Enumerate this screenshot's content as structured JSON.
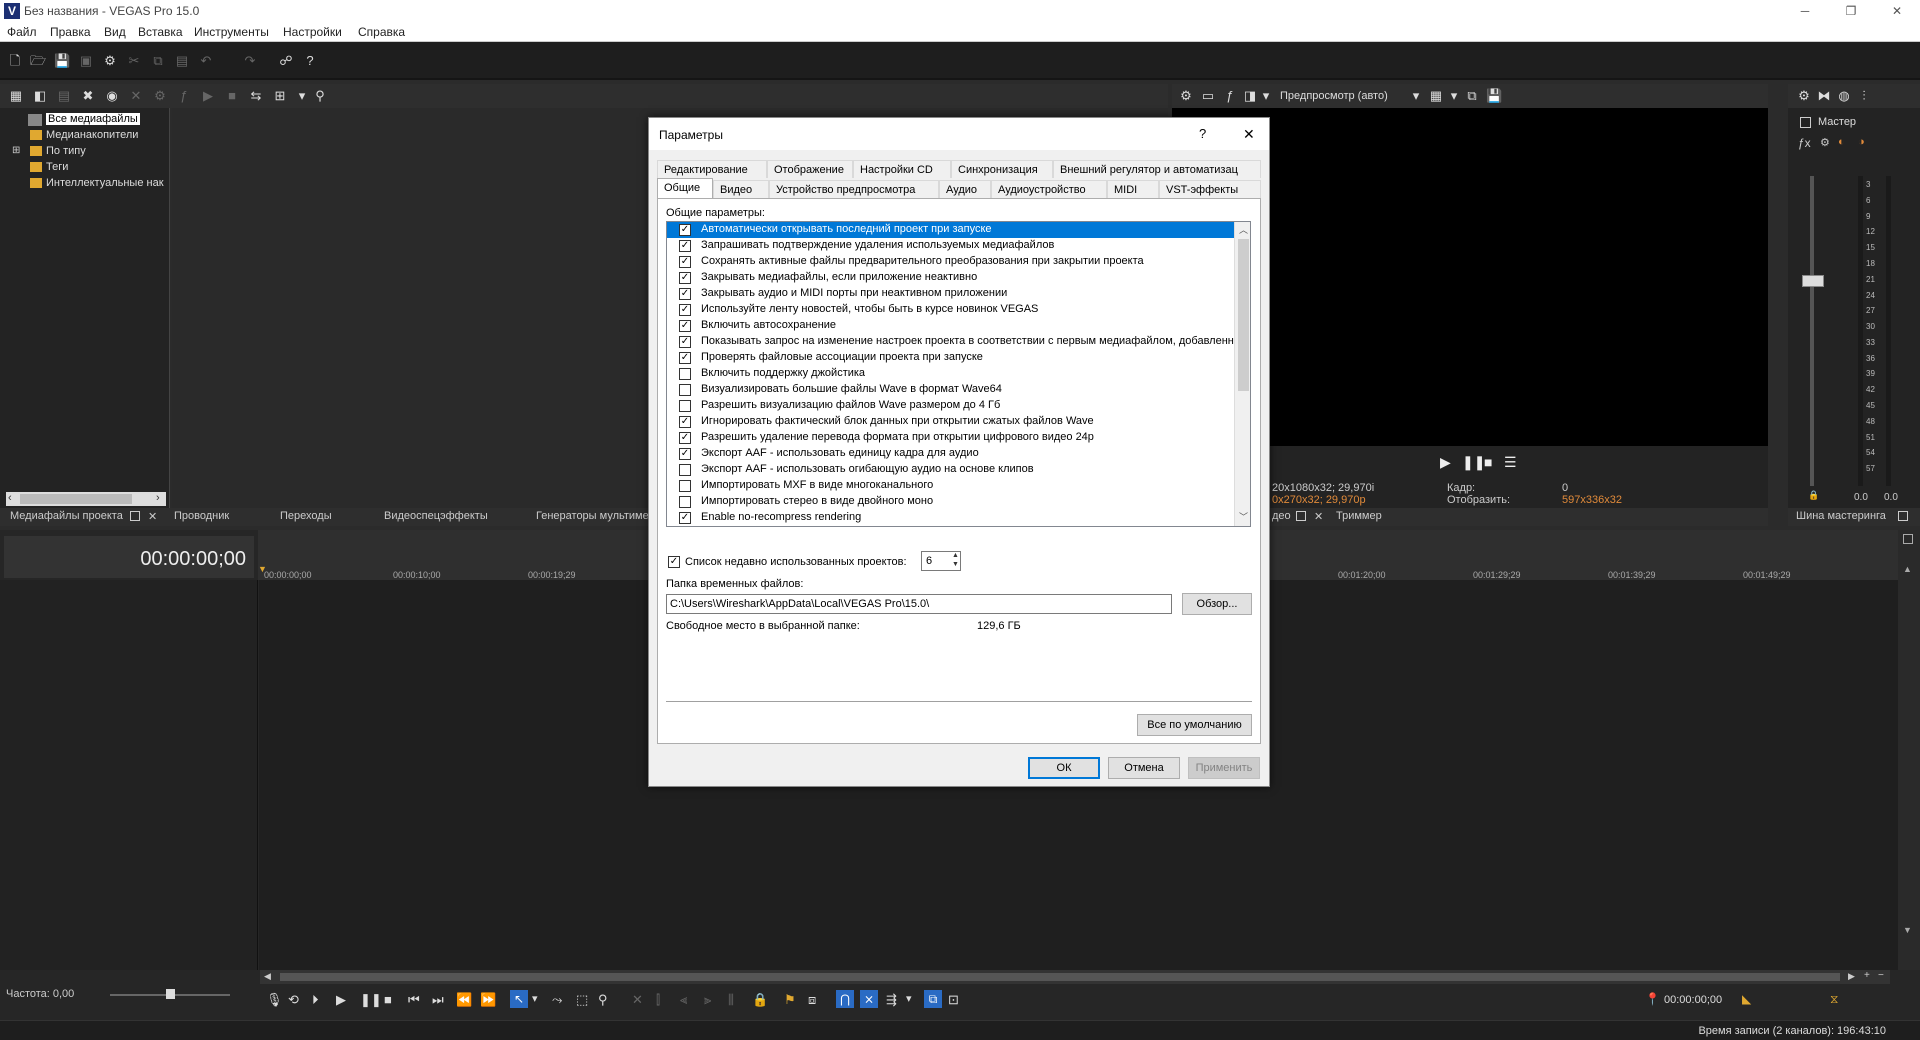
{
  "app": {
    "title": "Без названия - VEGAS Pro 15.0",
    "logo": "V"
  },
  "menu": [
    "Файл",
    "Правка",
    "Вид",
    "Вставка",
    "Инструменты",
    "Настройки",
    "Справка"
  ],
  "explorer": {
    "tree": [
      "Все медиафайлы",
      "Медианакопители",
      "По типу",
      "Теги",
      "Интеллектуальные нак"
    ],
    "expand_glyph": "⊞"
  },
  "bottom_tabs": [
    "Медиафайлы проекта",
    "Проводник",
    "Переходы",
    "Видеоспецэффекты",
    "Генераторы мультиме"
  ],
  "preview": {
    "mode": "Предпросмотр (авто)",
    "info_left_1": "20x1080x32; 29,970i",
    "info_left_2": "0x270x32; 29,970p",
    "frame_label": "Кадр:",
    "frame_value": "0",
    "display_label": "Отобразить:",
    "display_value": "597x336x32",
    "tabs": [
      "део",
      "Триммер"
    ]
  },
  "master": {
    "label": "Мастер",
    "tab": "Шина мастеринга",
    "scale": [
      "3",
      "6",
      "9",
      "12",
      "15",
      "18",
      "21",
      "24",
      "27",
      "30",
      "33",
      "36",
      "39",
      "42",
      "45",
      "48",
      "51",
      "54",
      "57"
    ],
    "val_l": "0.0",
    "val_r": "0.0"
  },
  "timeline": {
    "timecode": "00:00:00;00",
    "ruler": [
      "00:00:00;00",
      "00:00:10;00",
      "00:00:19;29",
      "00:01:20;00",
      "00:01:29;29",
      "00:01:39;29",
      "00:01:49;29"
    ],
    "rate_label": "Частота: 0,00",
    "end_timecode": "00:00:00;00",
    "status": "Время записи (2 каналов): 196:43:10"
  },
  "dialog": {
    "title": "Параметры",
    "help": "?",
    "close": "✕",
    "tabs_row1": [
      "Редактирование",
      "Отображение",
      "Настройки CD",
      "Синхронизация",
      "Внешний регулятор и автоматизац"
    ],
    "tabs_row2": [
      "Общие",
      "Видео",
      "Устройство предпросмотра",
      "Аудио",
      "Аудиоустройство",
      "MIDI",
      "VST-эффекты"
    ],
    "group_label": "Общие параметры:",
    "options": [
      {
        "label": "Автоматически открывать последний проект при запуске",
        "checked": true,
        "selected": true
      },
      {
        "label": "Запрашивать подтверждение удаления используемых медиафайлов",
        "checked": true
      },
      {
        "label": "Сохранять активные файлы предварительного преобразования при закрытии проекта",
        "checked": true
      },
      {
        "label": "Закрывать медиафайлы, если приложение неактивно",
        "checked": true
      },
      {
        "label": "Закрывать аудио и MIDI порты при неактивном приложении",
        "checked": true
      },
      {
        "label": "Используйте ленту новостей, чтобы быть в курсе новинок VEGAS",
        "checked": true
      },
      {
        "label": "Включить автосохранение",
        "checked": true
      },
      {
        "label": "Показывать запрос на изменение настроек проекта в соответствии с первым медиафайлом, добавленн",
        "checked": true
      },
      {
        "label": "Проверять файловые ассоциации проекта при запуске",
        "checked": true
      },
      {
        "label": "Включить поддержку джойстика",
        "checked": false
      },
      {
        "label": "Визуализировать большие файлы Wave в формат Wave64",
        "checked": false
      },
      {
        "label": "Разрешить визуализацию файлов Wave размером до 4 Гб",
        "checked": false
      },
      {
        "label": "Игнорировать фактический блок данных при открытии сжатых файлов Wave",
        "checked": true
      },
      {
        "label": "Разрешить удаление перевода формата при открытии цифрового видео 24p",
        "checked": true
      },
      {
        "label": "Экспорт AAF - использовать единицу кадра для аудио",
        "checked": true
      },
      {
        "label": "Экспорт AAF - использовать огибающую аудио на основе клипов",
        "checked": false
      },
      {
        "label": "Импортировать MXF в виде многоканального",
        "checked": false
      },
      {
        "label": "Импортировать стерео в виде двойного моно",
        "checked": false
      },
      {
        "label": "Enable no-recompress rendering",
        "checked": true
      }
    ],
    "recent_label": "Список недавно использованных проектов:",
    "recent_value": "6",
    "temp_label": "Папка временных файлов:",
    "temp_path": "C:\\Users\\Wireshark\\AppData\\Local\\VEGAS Pro\\15.0\\",
    "browse": "Обзор...",
    "free_label": "Свободное место в выбранной папке:",
    "free_value": "129,6 ГБ",
    "defaults": "Все по умолчанию",
    "ok": "ОК",
    "cancel": "Отмена",
    "apply": "Применить"
  },
  "colors": {
    "selection": "#0078d7",
    "panel": "#232323",
    "accent_orange": "#e08a3a"
  }
}
